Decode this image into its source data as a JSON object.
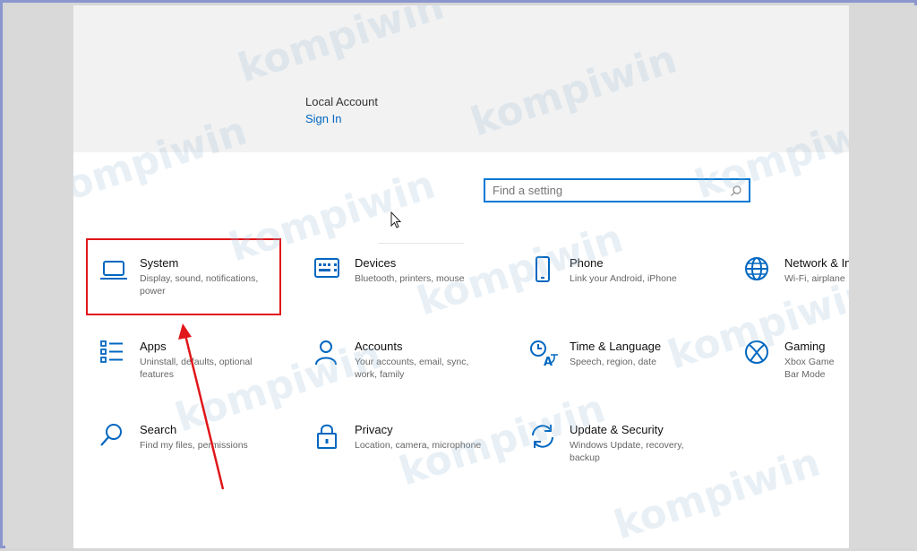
{
  "account": {
    "type": "Local Account",
    "sign_in": "Sign In"
  },
  "search": {
    "placeholder": "Find a setting"
  },
  "watermark": "kompiwin",
  "accent_color": "#0078d4",
  "highlight_color": "#e0161a",
  "tiles": [
    {
      "title": "System",
      "desc": "Display, sound, notifications, power",
      "icon": "laptop-icon"
    },
    {
      "title": "Devices",
      "desc": "Bluetooth, printers, mouse",
      "icon": "keyboard-icon"
    },
    {
      "title": "Phone",
      "desc": "Link your Android, iPhone",
      "icon": "phone-icon"
    },
    {
      "title": "Network & In",
      "desc": "Wi-Fi, airplane",
      "icon": "globe-icon"
    },
    {
      "title": "Apps",
      "desc": "Uninstall, defaults, optional features",
      "icon": "apps-list-icon"
    },
    {
      "title": "Accounts",
      "desc": "Your accounts, email, sync, work, family",
      "icon": "person-icon"
    },
    {
      "title": "Time & Language",
      "desc": "Speech, region, date",
      "icon": "time-language-icon"
    },
    {
      "title": "Gaming",
      "desc": "Xbox Game Bar Mode",
      "icon": "xbox-icon"
    },
    {
      "title": "Search",
      "desc": "Find my files, permissions",
      "icon": "search-icon"
    },
    {
      "title": "Privacy",
      "desc": "Location, camera, microphone",
      "icon": "lock-icon"
    },
    {
      "title": "Update & Security",
      "desc": "Windows Update, recovery, backup",
      "icon": "sync-icon"
    }
  ]
}
